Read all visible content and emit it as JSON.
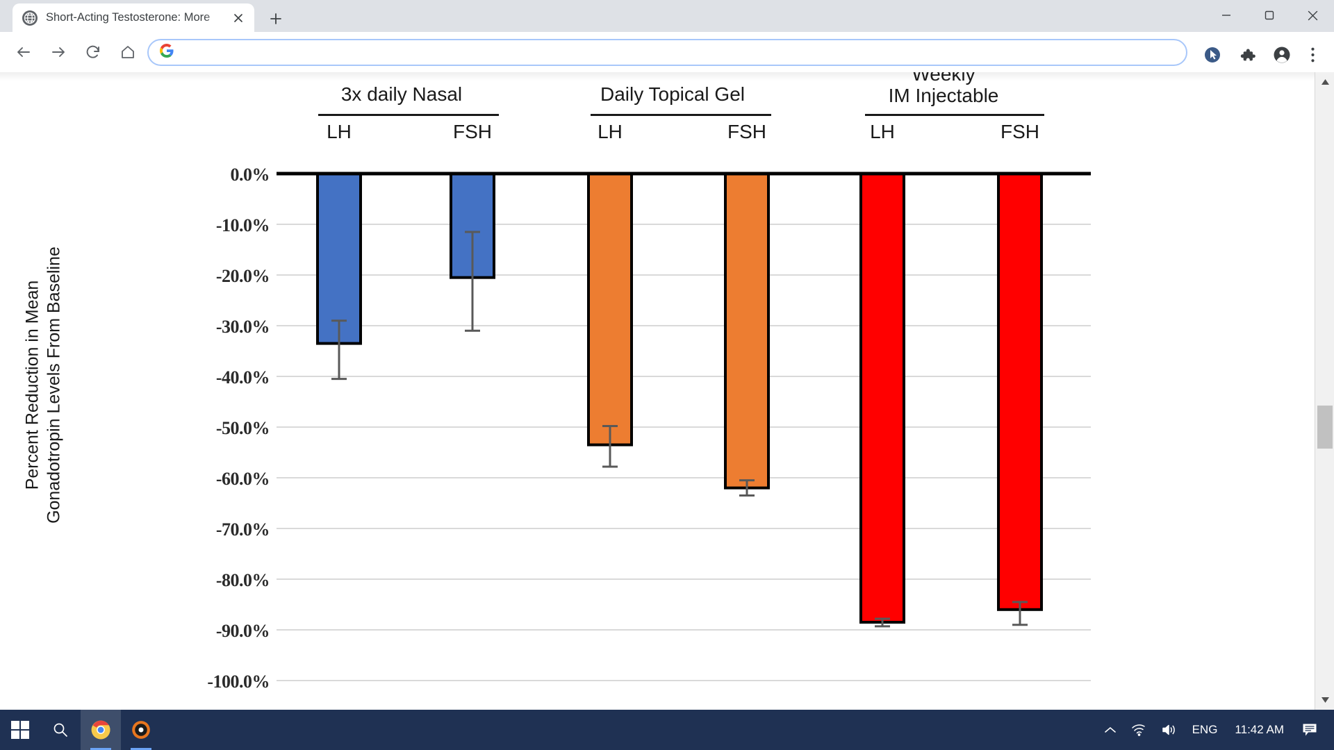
{
  "browser": {
    "tab": {
      "title": "Short-Acting Testosterone: More",
      "favicon_icon": "globe-icon",
      "close_icon": "close-icon"
    },
    "new_tab_label": "+",
    "window_controls": {
      "minimize": "minimize-icon",
      "maximize": "maximize-icon",
      "close": "window-close-icon"
    },
    "toolbar": {
      "back_icon": "back-arrow-icon",
      "forward_icon": "forward-arrow-icon",
      "reload_icon": "reload-icon",
      "home_icon": "home-icon",
      "omnibox_value": "",
      "omnibox_placeholder": "",
      "omnibox_leading_icon": "google-g-icon",
      "cursor_icon": "cursor-circle-icon",
      "extensions_icon": "puzzle-piece-icon",
      "profile_icon": "account-avatar-icon",
      "menu_icon": "three-dot-menu-icon"
    },
    "scrollbars": {
      "vertical_up": "chevron-up-icon",
      "vertical_down": "chevron-down-icon",
      "horizontal_right": "chevron-right-icon"
    }
  },
  "taskbar": {
    "start_icon": "windows-start-icon",
    "search_icon": "search-icon",
    "chrome_icon": "chrome-icon",
    "app_icon": "media-app-icon",
    "tray": {
      "overflow_icon": "chevron-up-icon",
      "network_icon": "wifi-icon",
      "volume_icon": "speaker-icon",
      "language": "ENG",
      "clock": "11:42 AM",
      "notifications_icon": "notification-icon"
    }
  },
  "chart_data": {
    "type": "bar",
    "title": "",
    "xlabel": "",
    "ylabel_line1": "Percent Reduction in Mean",
    "ylabel_line2": "Gonadotropin Levels From Baseline",
    "ylim": [
      -100,
      0
    ],
    "ytick_labels": [
      "0.0%",
      "-10.0%",
      "-20.0%",
      "-30.0%",
      "-40.0%",
      "-50.0%",
      "-60.0%",
      "-70.0%",
      "-80.0%",
      "-90.0%",
      "-100.0%"
    ],
    "ytick_values": [
      0,
      -10,
      -20,
      -30,
      -40,
      -50,
      -60,
      -70,
      -80,
      -90,
      -100
    ],
    "grid": true,
    "legend": "none",
    "groups": [
      {
        "label": "3x daily Nasal",
        "label_lines": [
          "3x daily Nasal"
        ],
        "color": "#4472C4"
      },
      {
        "label": "Daily Topical Gel",
        "label_lines": [
          "Daily Topical Gel"
        ],
        "color": "#ED7D31"
      },
      {
        "label": "Weekly IM Injectable",
        "label_lines": [
          "Weekly",
          "IM Injectable"
        ],
        "color": "#FF0000"
      }
    ],
    "categories": [
      "LH",
      "FSH",
      "LH",
      "FSH",
      "LH",
      "FSH"
    ],
    "bars": [
      {
        "group": "3x daily Nasal",
        "analyte": "LH",
        "value": -33.5,
        "err_low": -40.5,
        "err_high": -29.0,
        "color": "#4472C4"
      },
      {
        "group": "3x daily Nasal",
        "analyte": "FSH",
        "value": -20.5,
        "err_low": -31.0,
        "err_high": -11.5,
        "color": "#4472C4"
      },
      {
        "group": "Daily Topical Gel",
        "analyte": "LH",
        "value": -53.5,
        "err_low": -57.8,
        "err_high": -49.8,
        "color": "#ED7D31"
      },
      {
        "group": "Daily Topical Gel",
        "analyte": "FSH",
        "value": -62.0,
        "err_low": -63.5,
        "err_high": -60.5,
        "color": "#ED7D31"
      },
      {
        "group": "Weekly IM Injectable",
        "analyte": "LH",
        "value": -88.5,
        "err_low": -89.3,
        "err_high": -87.8,
        "color": "#FF0000"
      },
      {
        "group": "Weekly IM Injectable",
        "analyte": "FSH",
        "value": -86.0,
        "err_low": -89.0,
        "err_high": -84.5,
        "color": "#FF0000"
      }
    ],
    "colors": {
      "nasal": "#4472C4",
      "gel": "#ED7D31",
      "injectable": "#FF0000",
      "axis": "#1a1a1a",
      "grid": "#d9d9d9"
    }
  }
}
